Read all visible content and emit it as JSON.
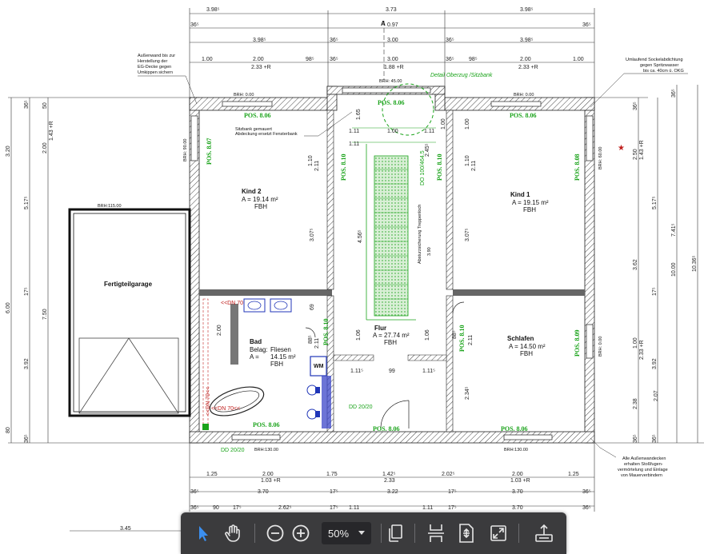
{
  "drawing": {
    "dims_top_row1": [
      "3.98⁵",
      "3.73",
      "3.98⁵"
    ],
    "dims_top_row2": [
      "36⁵",
      "0.97",
      "36⁵"
    ],
    "dims_top_row3": [
      "3.98⁵",
      "36⁵",
      "3.00",
      "36⁵",
      "3.98⁵"
    ],
    "dims_top_row4": [
      "1.00",
      "2.00",
      "98⁵",
      "36⁵",
      "3.00",
      "36⁵",
      "98⁵",
      "2.00",
      "1.00"
    ],
    "dims_top_row4b": [
      "2.33 +R",
      "1.88 +R",
      "2.33 +R"
    ],
    "dims_bottom_row1": [
      "1.25",
      "2.00",
      "1.75",
      "1.42⁵",
      "2.02⁵",
      "2.00",
      "1.25"
    ],
    "dims_bottom_row1b": [
      "1.03 +R",
      "2.33",
      "1.03 +R"
    ],
    "dims_bottom_row2": [
      "36⁵",
      "3.70",
      "17⁵",
      "3.22",
      "17⁵",
      "3.70",
      "36⁵"
    ],
    "dims_bottom_row3": [
      "36⁵",
      "90",
      "17⁵",
      "2.62⁵",
      "17⁵",
      "1.11",
      "1.11",
      "17⁵",
      "3.70",
      "36⁵"
    ],
    "dim_bottom_garage": "3.45",
    "dims_left_outer": [
      "3.20",
      "5.17⁵",
      "6.00",
      "3.92",
      "80"
    ],
    "dims_left_inner": [
      "36⁵",
      "50",
      "2.00",
      "1.43 +R",
      "17⁵",
      "7.50",
      "36⁵"
    ],
    "dims_right_outer": [
      "36⁵",
      "7.41⁵",
      "10.36⁵",
      "10.00",
      "2.07",
      "36⁵"
    ],
    "dims_right_inner": [
      "36⁵",
      "2.50",
      "1.43 +R",
      "5.17⁵",
      "3.62",
      "17⁵",
      "1.00",
      "2.33 +R",
      "3.92",
      "2.38",
      "36⁵"
    ],
    "rooms": {
      "kind2": {
        "name": "Kind 2",
        "area": "A =  19.14 m²",
        "floor": "FBH"
      },
      "kind1": {
        "name": "Kind 1",
        "area": "A =  19.15 m²",
        "floor": "FBH"
      },
      "bad": {
        "name": "Bad",
        "belag_label": "Belag:",
        "belag": "Fliesen",
        "area_label": "A =",
        "area": "14.15 m²",
        "floor": "FBH"
      },
      "flur": {
        "name": "Flur",
        "area": "A = 27.74 m²",
        "floor": "FBH"
      },
      "schlafen": {
        "name": "Schlafen",
        "area": "A =  14.50 m²",
        "floor": "FBH"
      },
      "garage": {
        "name": "Fertigteilgarage"
      }
    },
    "pos": [
      "POS. 8.06",
      "POS. 8.06",
      "POS. 8.06",
      "POS. 8.07",
      "POS. 8.10",
      "POS. 8.08",
      "POS. 8.10",
      "POS. 8.10",
      "POS. 8.10",
      "POS. 8.09",
      "POS. 8.06",
      "POS. 8.06",
      "POS. 8.06"
    ],
    "brh": {
      "top_left": "BRH: 0.00",
      "top_mid": "BRH: 45.00",
      "top_right": "BRH: 0.00",
      "left_wall": "BRH: 90.00",
      "right_wall": "BRH: 60.00",
      "garage": "BRH:115.00",
      "bottom_left": "BRH:130.00",
      "bottom_right": "BRH:130.00",
      "right_lower": "BRH: 0.00"
    },
    "notes": {
      "top_left": [
        "Außenwand bis zur",
        "Herstellung der",
        "EG-Decke gegen",
        "Umkippen sichern"
      ],
      "top_right": [
        "Umlaufend Sockelabdichtung",
        "gegen Spritzwasser",
        "bis ca. 40cm ü. OKG"
      ],
      "bottom_right": [
        "Alle Außenwandecken",
        "erhalten Stoßfugen-",
        "vermörtelung und Einlage",
        "von Mauerverbindern"
      ],
      "sill": [
        "Sitzbank gemauert",
        "Abdeckung ersetzt Fensterbank"
      ],
      "detail": "Detail Oberzug /Sitzbank",
      "stair": "Absturzsicherung Treppenloch",
      "stair_dim": "3.90",
      "stair_note": "DO 100/464.5",
      "section": "A",
      "dd_left": "DD 20/20",
      "dd_right": "DD 20/20",
      "dn_top": "<<DN 70",
      "dn_left": "<<DN 70<<",
      "dn_tub": "<<DN 70<<",
      "wm": "WM"
    },
    "inner_dims": [
      "1.65",
      "1.00",
      "1.11",
      "1.11",
      "1.11",
      "2.45⁵",
      "1.10",
      "2.11",
      "3.07⁵",
      "4.56⁵",
      "1.00",
      "2.11",
      "1.10",
      "3.07⁵",
      "69",
      "2.00",
      "88⁵",
      "2.11",
      "1.06",
      "1.06",
      "88⁵",
      "2.11",
      "1.11⁵",
      "99",
      "1.11⁵",
      "2.34⁵",
      "1.00"
    ]
  },
  "toolbar": {
    "zoom": "50%",
    "icons": [
      "pointer-icon",
      "hand-icon",
      "zoom-out-icon",
      "zoom-in-icon",
      "copy-pages-icon",
      "page-split-icon",
      "fit-page-icon",
      "expand-icon",
      "share-icon"
    ]
  }
}
